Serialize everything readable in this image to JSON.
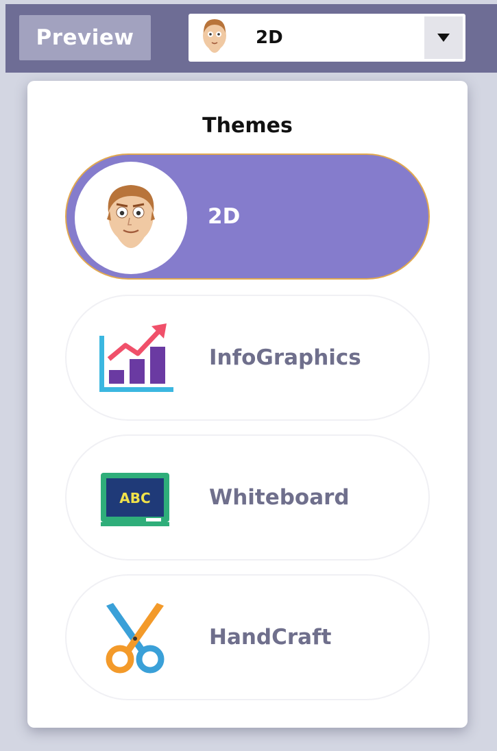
{
  "toolbar": {
    "preview_label": "Preview",
    "theme_select": {
      "selected": "2D",
      "avatar_icon": "cartoon-face-icon",
      "dropdown_icon": "triangle-down-icon"
    }
  },
  "themes_panel": {
    "title": "Themes",
    "items": [
      {
        "label": "2D",
        "icon": "cartoon-face-icon",
        "active": true
      },
      {
        "label": "InfoGraphics",
        "icon": "bar-chart-icon",
        "active": false
      },
      {
        "label": "Whiteboard",
        "icon": "chalkboard-icon",
        "active": false
      },
      {
        "label": "HandCraft",
        "icon": "scissors-icon",
        "active": false
      }
    ]
  },
  "colors": {
    "toolbar_bg": "#6e6d95",
    "active_item_bg": "#857ccc",
    "active_item_border": "#e2a94f",
    "inactive_label": "#6f6f8c"
  }
}
